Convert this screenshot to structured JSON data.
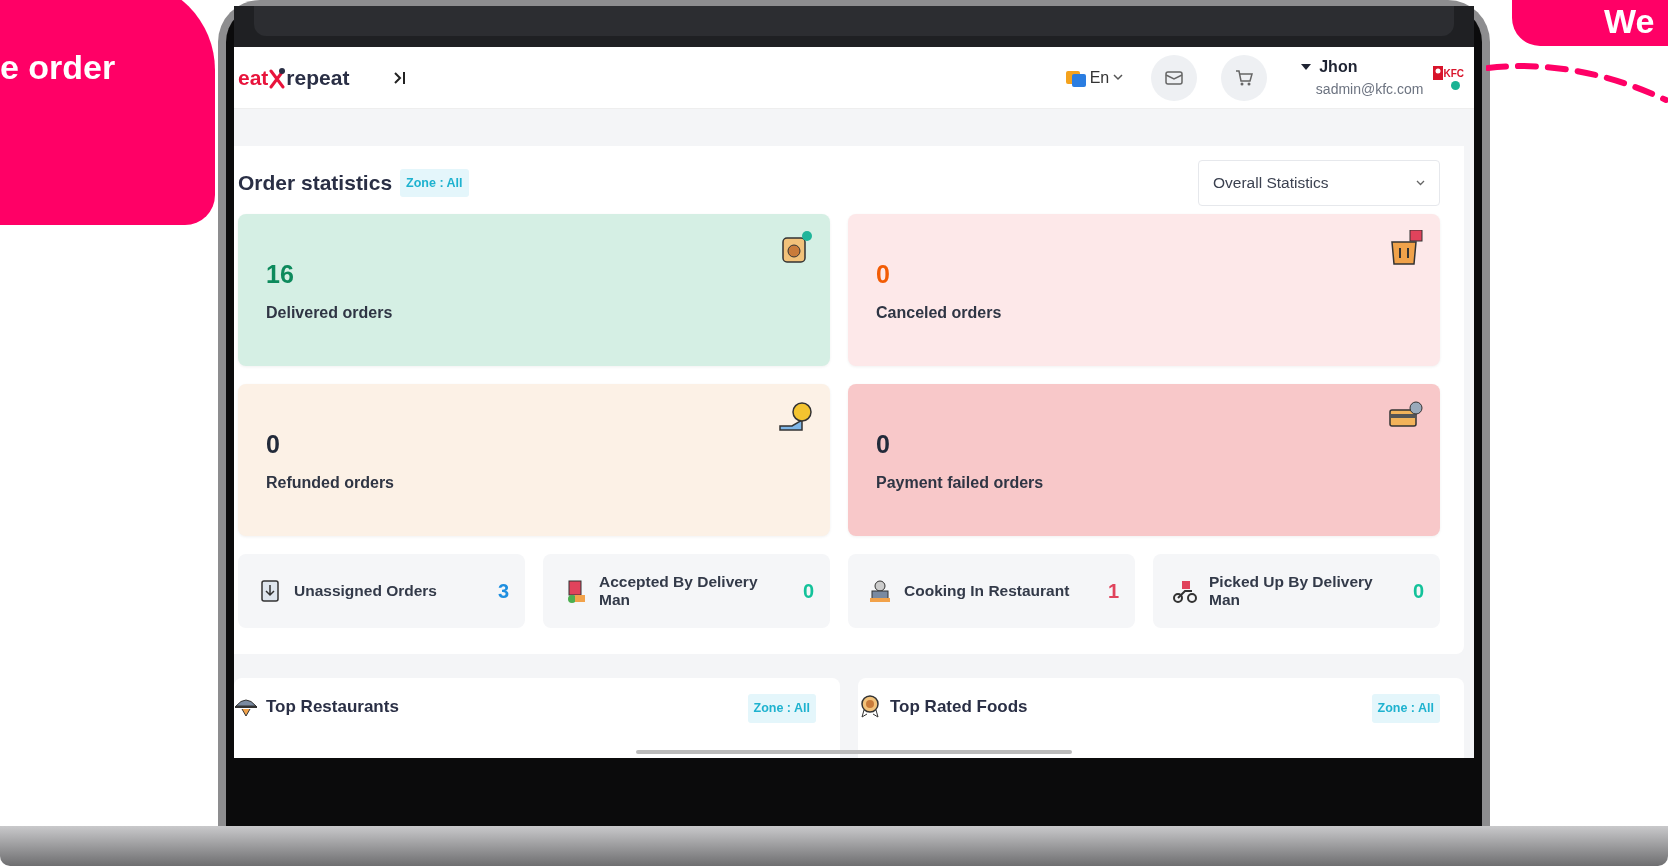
{
  "promo": {
    "left_bubble": "e order",
    "right_bubble": "We"
  },
  "header": {
    "logo_left": "eat",
    "logo_right": "repeat",
    "language": "En",
    "user": {
      "name": "Jhon",
      "email": "sadmin@kfc.com",
      "avatar_text": "KFC",
      "online": true
    }
  },
  "order_statistics": {
    "title": "Order statistics",
    "zone_badge": "Zone : All",
    "filter": "Overall Statistics",
    "cards": [
      {
        "kind": "delivered",
        "count": "16",
        "label": "Delivered orders"
      },
      {
        "kind": "canceled",
        "count": "0",
        "label": "Canceled orders"
      },
      {
        "kind": "refunded",
        "count": "0",
        "label": "Refunded orders"
      },
      {
        "kind": "failed",
        "count": "0",
        "label": "Payment failed orders"
      }
    ],
    "statuses": [
      {
        "kind": "unassigned",
        "label": "Unassigned Orders",
        "count": "3",
        "color": "#1f8fe0"
      },
      {
        "kind": "accepted",
        "label": "Accepted By Delivery Man",
        "count": "0",
        "color": "#13c29a"
      },
      {
        "kind": "cooking",
        "label": "Cooking In Restaurant",
        "count": "1",
        "color": "#e0435c"
      },
      {
        "kind": "picked",
        "label": "Picked Up By Delivery Man",
        "count": "0",
        "color": "#13c29a"
      }
    ]
  },
  "sections": [
    {
      "kind": "restaurants",
      "title": "Top Restaurants",
      "zone_badge": "Zone : All"
    },
    {
      "kind": "foods",
      "title": "Top Rated Foods",
      "zone_badge": "Zone : All"
    }
  ]
}
